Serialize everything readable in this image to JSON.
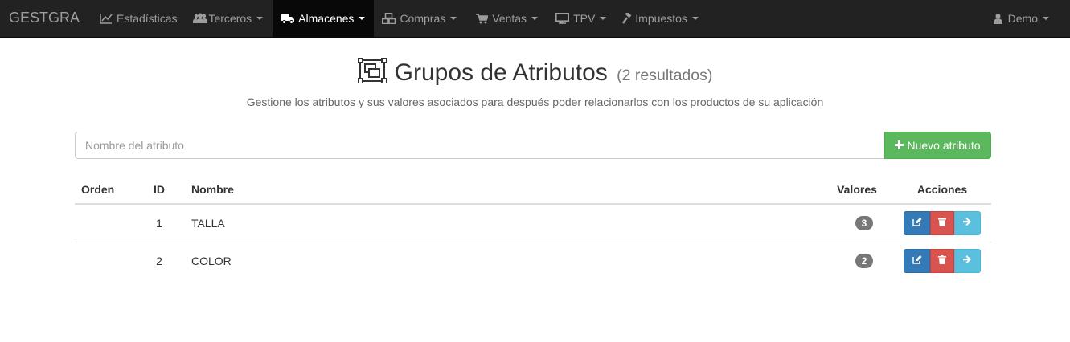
{
  "navbar": {
    "brand": "GESTGRA",
    "items": [
      {
        "label": "Estadísticas",
        "icon": "chart-line-icon",
        "caret": false,
        "active": false
      },
      {
        "label": "Terceros",
        "icon": "users-icon",
        "caret": true,
        "active": false
      },
      {
        "label": "Almacenes",
        "icon": "truck-icon",
        "caret": true,
        "active": true
      },
      {
        "label": "Compras",
        "icon": "cubes-icon",
        "caret": true,
        "active": false
      },
      {
        "label": "Ventas",
        "icon": "cart-icon",
        "caret": true,
        "active": false
      },
      {
        "label": "TPV",
        "icon": "desktop-icon",
        "caret": true,
        "active": false
      },
      {
        "label": "Impuestos",
        "icon": "gavel-icon",
        "caret": true,
        "active": false
      }
    ],
    "user": {
      "label": "Demo",
      "icon": "user-icon"
    }
  },
  "header": {
    "title": "Grupos de Atributos",
    "count": "(2 resultados)",
    "subtitle": "Gestione los atributos y sus valores asociados para después poder relacionarlos con los productos de su aplicación"
  },
  "search": {
    "placeholder": "Nombre del atributo",
    "new_button": "Nuevo atributo"
  },
  "table": {
    "headers": {
      "orden": "Orden",
      "id": "ID",
      "nombre": "Nombre",
      "valores": "Valores",
      "acciones": "Acciones"
    },
    "rows": [
      {
        "orden": "",
        "id": "1",
        "nombre": "TALLA",
        "valores": "3"
      },
      {
        "orden": "",
        "id": "2",
        "nombre": "COLOR",
        "valores": "2"
      }
    ]
  },
  "colors": {
    "navbar_bg": "#222222",
    "success": "#5cb85c",
    "primary": "#337ab7",
    "danger": "#d9534f",
    "info": "#5bc0de"
  }
}
